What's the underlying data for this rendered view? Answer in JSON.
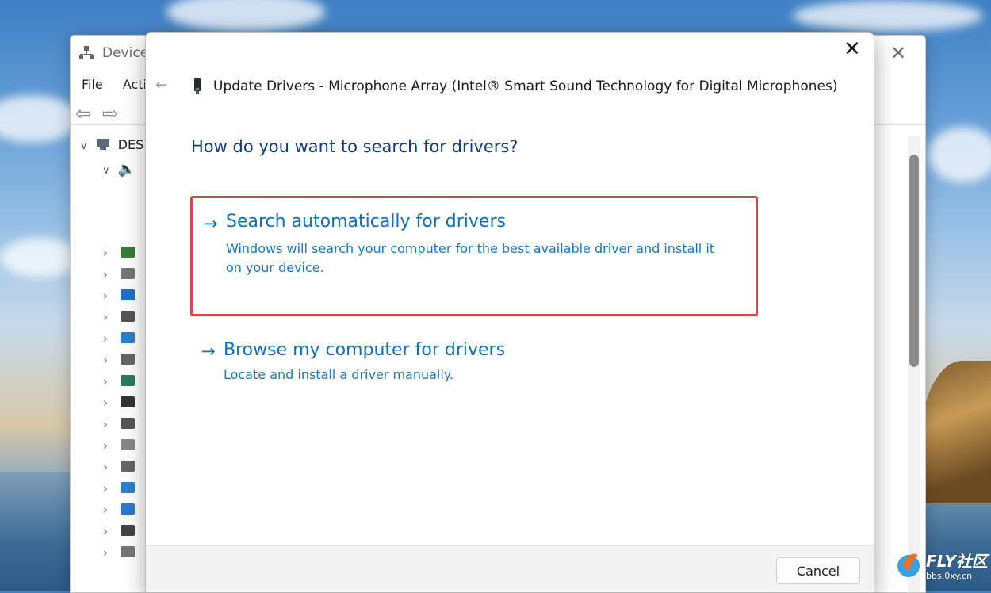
{
  "background_window": {
    "title": "Device",
    "menu": [
      "File",
      "Acti"
    ],
    "tree_root_label": "DES",
    "tree_icons": [
      "network-adapter-icon",
      "biometric-icon",
      "bluetooth-icon",
      "camera-icon",
      "monitor-icon",
      "disk-drive-icon",
      "display-adapter-icon",
      "firmware-icon",
      "hid-icon",
      "keyboard-icon",
      "mouse-icon",
      "monitor-icon",
      "network-icon",
      "print-queue-icon",
      "printer-icon"
    ]
  },
  "dialog": {
    "title": "Update Drivers - Microphone Array (Intel® Smart Sound Technology for Digital Microphones)",
    "heading": "How do you want to search for drivers?",
    "options": [
      {
        "title": "Search automatically for drivers",
        "description": "Windows will search your computer for the best available driver and install it on your device."
      },
      {
        "title": "Browse my computer for drivers",
        "description": "Locate and install a driver manually."
      }
    ],
    "cancel_label": "Cancel"
  },
  "watermark": {
    "text": "FLY社区",
    "url": "bbs.0xy.cn"
  },
  "colors": {
    "heading": "#0a3d8c",
    "link": "#0c6fbf",
    "highlight_border": "#d9454a"
  }
}
